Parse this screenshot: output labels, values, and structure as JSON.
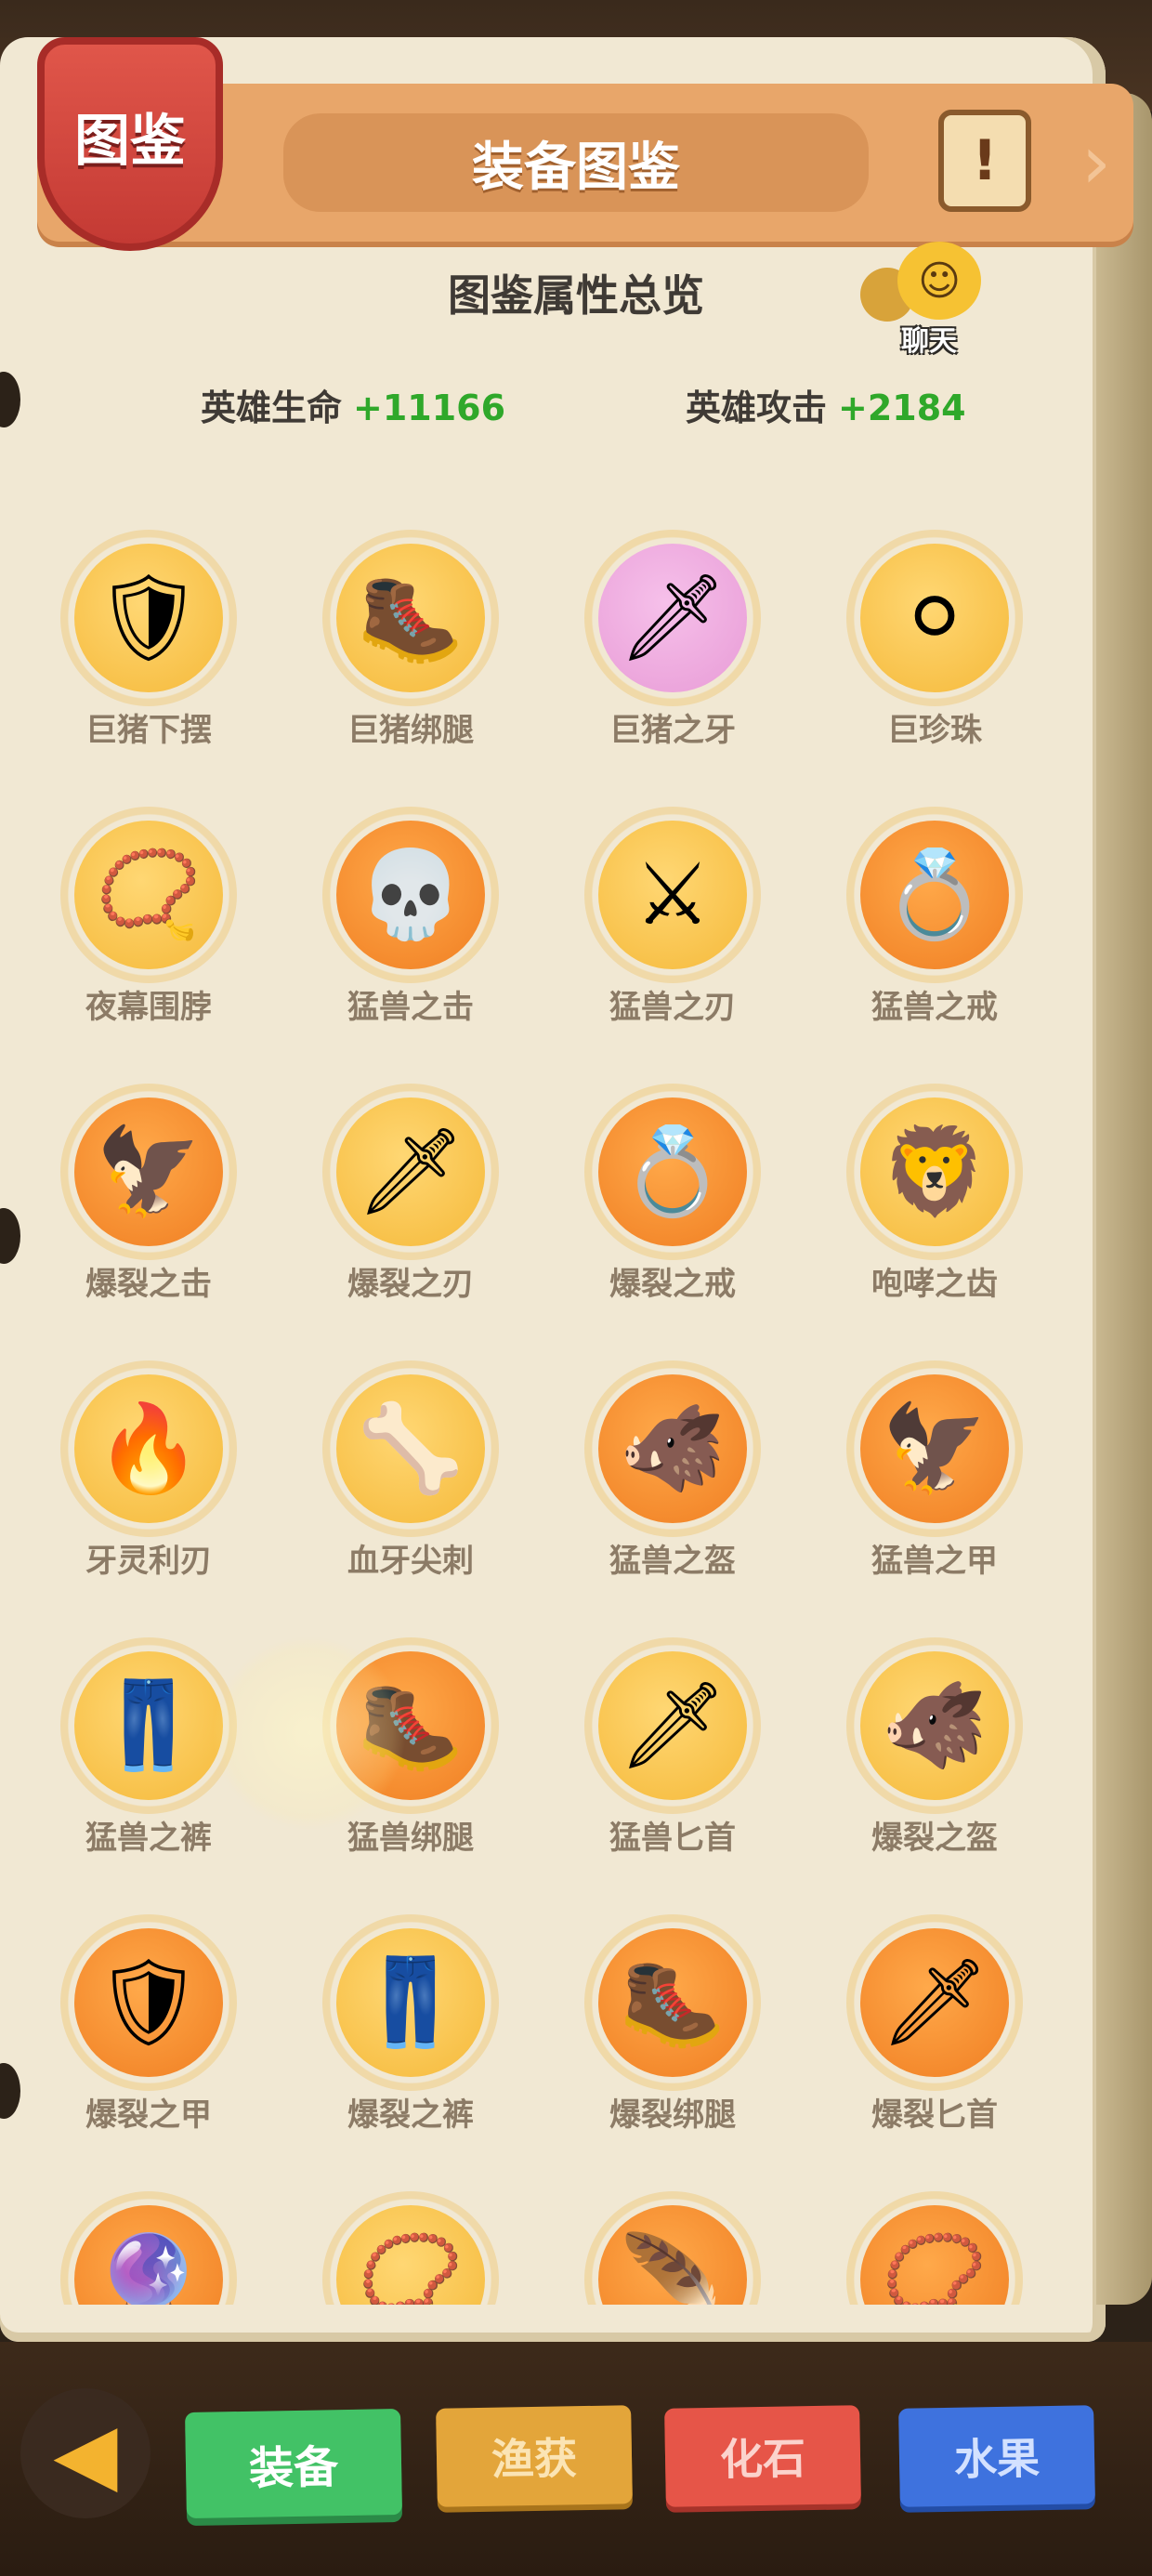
{
  "header": {
    "badge_label": "图鉴",
    "title": "装备图鉴",
    "scroll_icon": "scroll-exclamation-icon",
    "next_icon": "chevron-right-icon"
  },
  "summary": {
    "title": "图鉴属性总览",
    "hp_label": "英雄生命",
    "hp_value": "+11166",
    "atk_label": "英雄攻击",
    "atk_value": "+2184"
  },
  "chat": {
    "label": "聊天",
    "icon": "chat-bubbles-icon"
  },
  "items": [
    {
      "name": "巨猪下摆",
      "icon": "🛡",
      "rarity": "gold"
    },
    {
      "name": "巨猪绑腿",
      "icon": "🥾",
      "rarity": "gold"
    },
    {
      "name": "巨猪之牙",
      "icon": "🗡",
      "rarity": "pink"
    },
    {
      "name": "巨珍珠",
      "icon": "⚪",
      "rarity": "gold"
    },
    {
      "name": "夜幕围脖",
      "icon": "📿",
      "rarity": "gold"
    },
    {
      "name": "猛兽之击",
      "icon": "💀",
      "rarity": "orange"
    },
    {
      "name": "猛兽之刃",
      "icon": "⚔",
      "rarity": "gold"
    },
    {
      "name": "猛兽之戒",
      "icon": "💍",
      "rarity": "orange"
    },
    {
      "name": "爆裂之击",
      "icon": "🦅",
      "rarity": "orange"
    },
    {
      "name": "爆裂之刃",
      "icon": "🗡",
      "rarity": "gold"
    },
    {
      "name": "爆裂之戒",
      "icon": "💍",
      "rarity": "orange"
    },
    {
      "name": "咆哮之齿",
      "icon": "🦁",
      "rarity": "gold"
    },
    {
      "name": "牙灵利刃",
      "icon": "🔥",
      "rarity": "gold"
    },
    {
      "name": "血牙尖刺",
      "icon": "🦴",
      "rarity": "gold"
    },
    {
      "name": "猛兽之盔",
      "icon": "🐗",
      "rarity": "orange"
    },
    {
      "name": "猛兽之甲",
      "icon": "🦅",
      "rarity": "orange"
    },
    {
      "name": "猛兽之裤",
      "icon": "👖",
      "rarity": "gold"
    },
    {
      "name": "猛兽绑腿",
      "icon": "🥾",
      "rarity": "orange"
    },
    {
      "name": "猛兽匕首",
      "icon": "🗡",
      "rarity": "gold"
    },
    {
      "name": "爆裂之盔",
      "icon": "🐗",
      "rarity": "gold"
    },
    {
      "name": "爆裂之甲",
      "icon": "🛡",
      "rarity": "orange"
    },
    {
      "name": "爆裂之裤",
      "icon": "👖",
      "rarity": "gold"
    },
    {
      "name": "爆裂绑腿",
      "icon": "🥾",
      "rarity": "orange"
    },
    {
      "name": "爆裂匕首",
      "icon": "🗡",
      "rarity": "orange"
    },
    {
      "name": "",
      "icon": "🔮",
      "rarity": "orange"
    },
    {
      "name": "",
      "icon": "📿",
      "rarity": "gold"
    },
    {
      "name": "",
      "icon": "🪶",
      "rarity": "orange"
    },
    {
      "name": "",
      "icon": "📿",
      "rarity": "orange"
    }
  ],
  "bottom_nav": {
    "back_icon": "arrow-left-icon",
    "tabs": {
      "equip": "装备",
      "fish": "渔获",
      "fossil": "化石",
      "fruit": "水果"
    }
  }
}
